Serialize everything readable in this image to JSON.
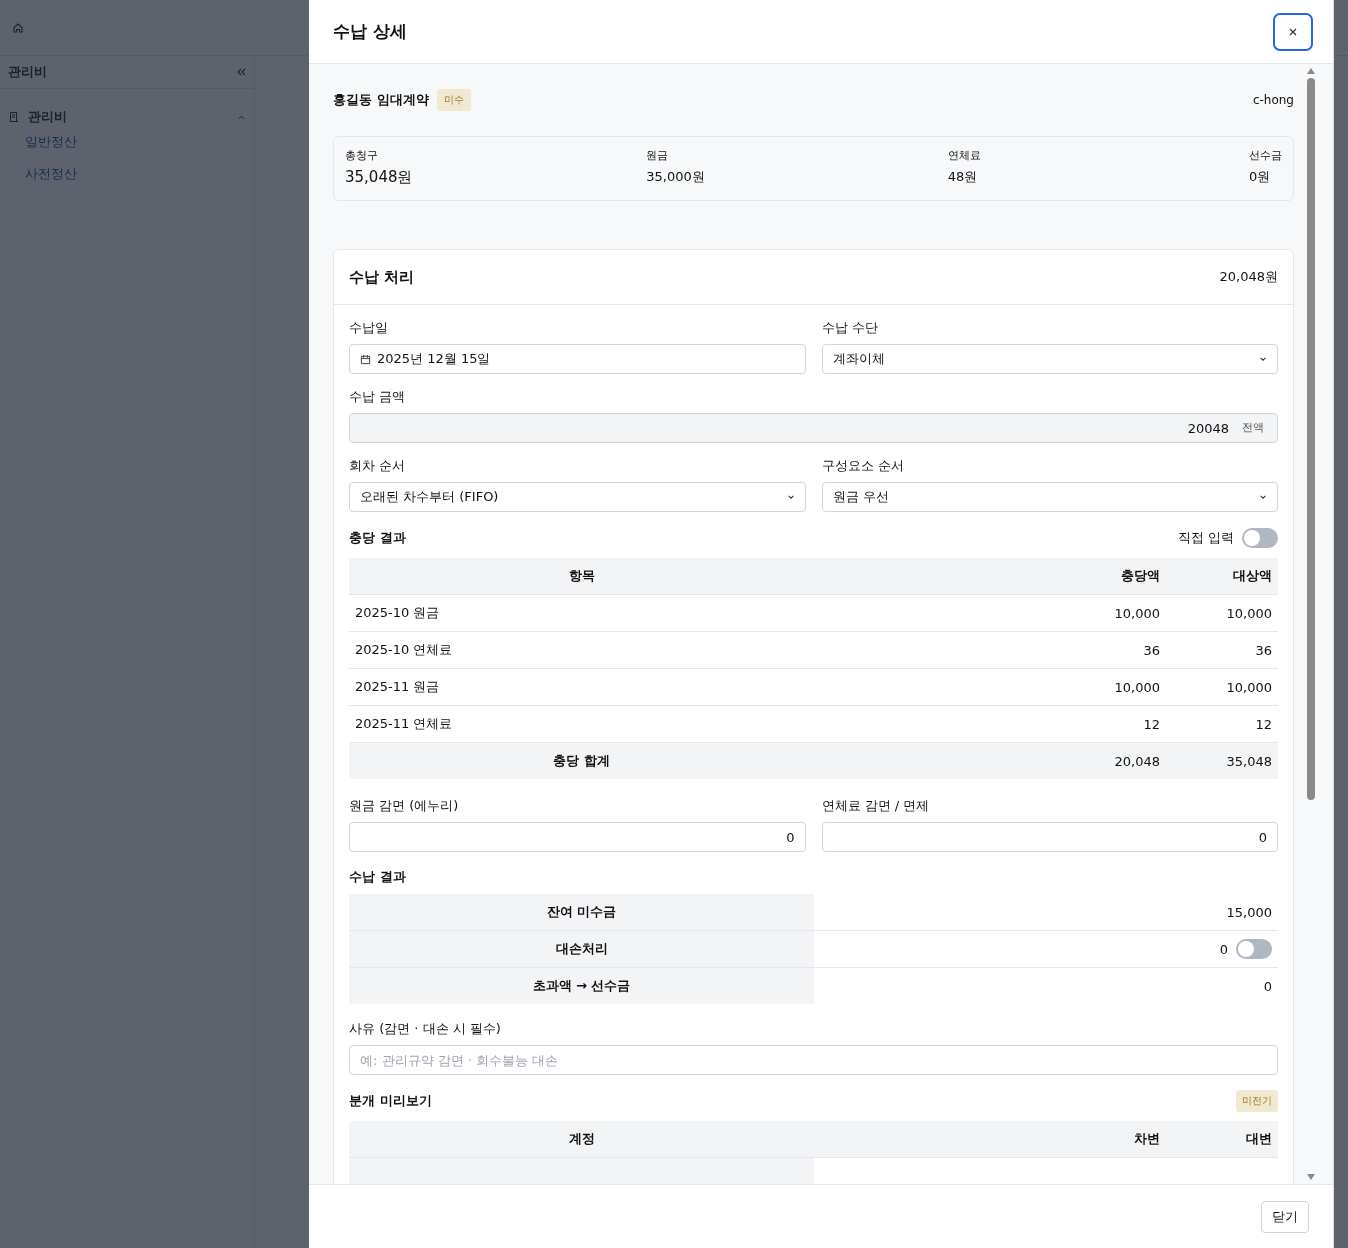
{
  "sidebar": {
    "title": "관리비",
    "group": {
      "label": "관리비",
      "expanded": true,
      "items": [
        {
          "label": "일반정산"
        },
        {
          "label": "사전정산"
        }
      ]
    }
  },
  "drawer": {
    "title": "수납 상세",
    "contract": {
      "name": "홍길동 임대계약",
      "badge": "미수",
      "user": "c-hong"
    },
    "summary": [
      {
        "label": "총청구",
        "value": "35,048원",
        "emphasis": true
      },
      {
        "label": "원금",
        "value": "35,000원",
        "emphasis": false
      },
      {
        "label": "연체료",
        "value": "48원",
        "emphasis": false
      },
      {
        "label": "선수금",
        "value": "0원",
        "emphasis": false
      }
    ],
    "payment": {
      "title": "수납 처리",
      "amount": "20,048원",
      "date": {
        "label": "수납일",
        "value": "2025년 12월 15일"
      },
      "method": {
        "label": "수납 수단",
        "value": "계좌이체"
      },
      "pay_amount": {
        "label": "수납 금액",
        "value": "20048",
        "button": "전액"
      },
      "round_order": {
        "label": "회차 순서",
        "value": "오래된 차수부터 (FIFO)"
      },
      "component_order": {
        "label": "구성요소 순서",
        "value": "원금 우선"
      },
      "allocation": {
        "title": "충당 결과",
        "manual": {
          "label": "직접 입력",
          "on": false
        },
        "columns": [
          "항목",
          "충당액",
          "대상액"
        ],
        "rows": [
          {
            "item": "2025-10 원금",
            "allocated": "10,000",
            "target": "10,000"
          },
          {
            "item": "2025-10 연체료",
            "allocated": "36",
            "target": "36"
          },
          {
            "item": "2025-11 원금",
            "allocated": "10,000",
            "target": "10,000"
          },
          {
            "item": "2025-11 연체료",
            "allocated": "12",
            "target": "12"
          }
        ],
        "total": {
          "label": "충당 합계",
          "allocated": "20,048",
          "target": "35,048"
        }
      },
      "discounts": [
        {
          "label": "원금 감면 (에누리)",
          "value": "0"
        },
        {
          "label": "연체료 감면 / 면제",
          "value": "0"
        }
      ],
      "result": {
        "title": "수납 결과",
        "rows": [
          {
            "kind": "text",
            "label": "잔여 미수금",
            "value": "15,000"
          },
          {
            "kind": "toggle",
            "label": "대손처리",
            "value": "0",
            "on": false
          },
          {
            "kind": "text",
            "label": "초과액 → 선수금",
            "value": "0"
          }
        ]
      },
      "reason": {
        "label": "사유 (감면 · 대손 시 필수)",
        "placeholder": "예: 관리규약 감면 · 회수불능 대손"
      },
      "journal": {
        "title": "분개 미리보기",
        "badge": "미전기",
        "columns": [
          "계정",
          "차변",
          "대변"
        ]
      }
    },
    "footer_button": "닫기"
  }
}
